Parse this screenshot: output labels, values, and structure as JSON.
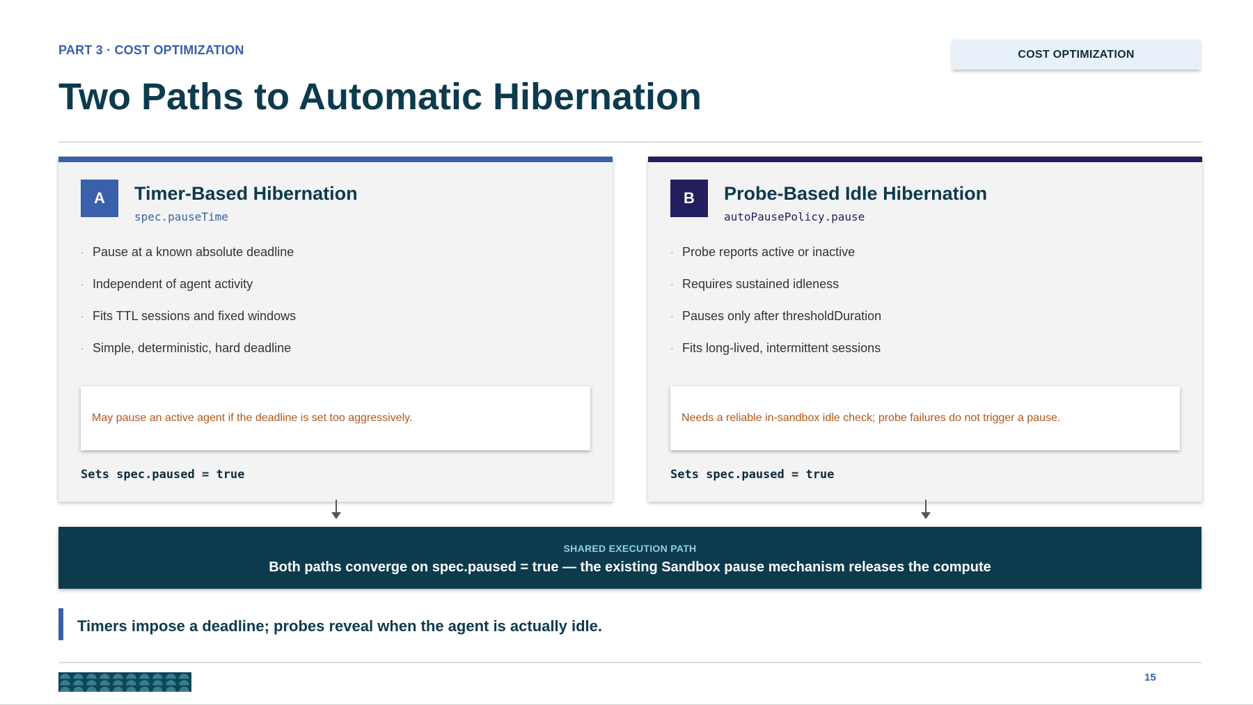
{
  "header": {
    "kicker": "PART 3 · COST OPTIMIZATION",
    "tag": "COST OPTIMIZATION",
    "title": "Two Paths to Automatic Hibernation"
  },
  "cards": [
    {
      "badge": "A",
      "title": "Timer-Based Hibernation",
      "code": "spec.pauseTime",
      "accent_color": "#3a5fab",
      "bullets": [
        "Pause at a known absolute deadline",
        "Independent of agent activity",
        "Fits TTL sessions and fixed windows",
        "Simple, deterministic, hard deadline"
      ],
      "note": "May pause an active agent if the deadline is set too aggressively.",
      "sets": "Sets spec.paused = true"
    },
    {
      "badge": "B",
      "title": "Probe-Based Idle Hibernation",
      "code": "autoPausePolicy.pause",
      "accent_color": "#231f5e",
      "bullets": [
        "Probe reports active or inactive",
        "Requires sustained idleness",
        "Pauses only after thresholdDuration",
        "Fits long-lived, intermittent sessions"
      ],
      "note": "Needs a reliable in-sandbox idle check; probe failures do not trigger a pause.",
      "sets": "Sets spec.paused = true"
    }
  ],
  "bullet_glyph": "·",
  "banner": {
    "label": "SHARED EXECUTION PATH",
    "text": "Both paths converge on spec.paused = true — the existing Sandbox pause mechanism releases the compute"
  },
  "takeaway": "Timers impose a deadline; probes reveal when the agent is actually idle.",
  "footer": {
    "page_number": "15"
  },
  "colors": {
    "title": "#0d3a4d",
    "kicker": "#3a5fab",
    "note_text": "#b4561b",
    "banner_bg": "#0d3b4d",
    "banner_label": "#8fd0e6"
  }
}
